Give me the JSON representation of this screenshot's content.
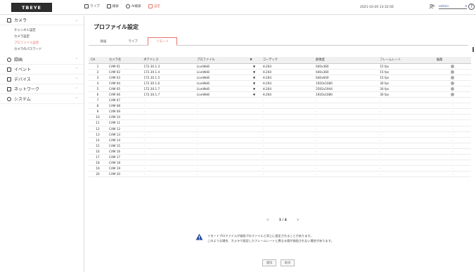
{
  "header": {
    "logo": "TBEYE",
    "nav": [
      {
        "label": "ライブ",
        "icon": "live-icon",
        "active": false
      },
      {
        "label": "検索",
        "icon": "search-icon",
        "active": false
      },
      {
        "label": "AI検索",
        "icon": "ai-search-icon",
        "active": false
      },
      {
        "label": "設定",
        "icon": "settings-icon",
        "active": true
      }
    ],
    "datetime": "2021-10-20 13:32:56",
    "user": "admin",
    "help": "?"
  },
  "sidebar": {
    "sections": [
      {
        "label": "カメラ",
        "icon": "camera-icon",
        "expanded": true,
        "items": [
          "チャンネル設定",
          "カメラ設定",
          "プロファイル設定",
          "カメラのパスワード"
        ],
        "active_item": 2
      },
      {
        "label": "録画",
        "icon": "record-icon"
      },
      {
        "label": "イベント",
        "icon": "event-icon"
      },
      {
        "label": "デバイス",
        "icon": "device-icon"
      },
      {
        "label": "ネットワーク",
        "icon": "network-icon"
      },
      {
        "label": "システム",
        "icon": "system-icon"
      }
    ]
  },
  "main": {
    "title": "プロファイル設定",
    "tabs": [
      "録画",
      "ライブ",
      "リモート"
    ],
    "active_tab": 2,
    "columns": [
      "CH",
      "カメラ名",
      "IPアドレス",
      "プロファイル",
      "▼",
      "コーデック",
      "解像度",
      "フレームレート",
      "編集"
    ],
    "rows": [
      [
        "1",
        "CAM 01",
        "172.30.1.3",
        "LiveWeB",
        "▼",
        "H.264",
        "640x360",
        "15 fps"
      ],
      [
        "2",
        "CAM 02",
        "172.30.1.4",
        "LiveWeB",
        "▼",
        "H.264",
        "640x360",
        "15 fps"
      ],
      [
        "3",
        "CAM 03",
        "172.30.1.5",
        "LiveWeB",
        "▼",
        "H.264",
        "640x640",
        "15 fps"
      ],
      [
        "4",
        "CAM 04",
        "172.30.1.6",
        "LiveWeB",
        "▼",
        "H.264",
        "1920x1080",
        "30 fps"
      ],
      [
        "5",
        "CAM 05",
        "172.30.1.7",
        "LiveWeB",
        "▼",
        "H.264",
        "2592x1944",
        "30 fps"
      ],
      [
        "6",
        "CAM 06",
        "172.30.1.7",
        "LiveWeB",
        "▼",
        "H.264",
        "1920x1080",
        "30 fps"
      ],
      [
        "7",
        "CAM 07",
        "-",
        "-",
        "",
        "-",
        "-",
        "-"
      ],
      [
        "8",
        "CAM 08",
        "-",
        "-",
        "",
        "-",
        "-",
        "-"
      ],
      [
        "9",
        "CAM 09",
        "-",
        "-",
        "",
        "-",
        "-",
        "-"
      ],
      [
        "10",
        "CAM 10",
        "-",
        "-",
        "",
        "-",
        "-",
        "-"
      ],
      [
        "11",
        "CAM 11",
        "-",
        "-",
        "",
        "-",
        "-",
        "-"
      ],
      [
        "12",
        "CAM 12",
        "-",
        "-",
        "",
        "-",
        "-",
        "-"
      ],
      [
        "13",
        "CAM 13",
        "-",
        "-",
        "",
        "-",
        "-",
        "-"
      ],
      [
        "14",
        "CAM 14",
        "-",
        "-",
        "",
        "-",
        "-",
        "-"
      ],
      [
        "15",
        "CAM 15",
        "-",
        "-",
        "",
        "-",
        "-",
        "-"
      ],
      [
        "16",
        "CAM 16",
        "-",
        "-",
        "",
        "-",
        "-",
        "-"
      ],
      [
        "17",
        "CAM 17",
        "-",
        "-",
        "",
        "-",
        "-",
        "-"
      ],
      [
        "18",
        "CAM 18",
        "-",
        "-",
        "",
        "-",
        "-",
        "-"
      ],
      [
        "19",
        "CAM 19",
        "-",
        "-",
        "",
        "-",
        "-",
        "-"
      ],
      [
        "20",
        "CAM 20",
        "-",
        "-",
        "",
        "-",
        "-",
        "-"
      ]
    ],
    "pager": {
      "prev": "<",
      "page": "1 / 4",
      "next": ">"
    },
    "note": [
      "リモートプロファイルが録画プロファイルと同じに設定されることがあります。",
      "このような場合、カメラで設定したフレームレートと異なる値が録画されない場合があります。"
    ],
    "buttons": {
      "apply": "適用",
      "cancel": "取消"
    }
  },
  "colors": {
    "accent": "#e0776a",
    "logo_bg": "#2e2e2e",
    "warn": "#2b4fa0"
  }
}
